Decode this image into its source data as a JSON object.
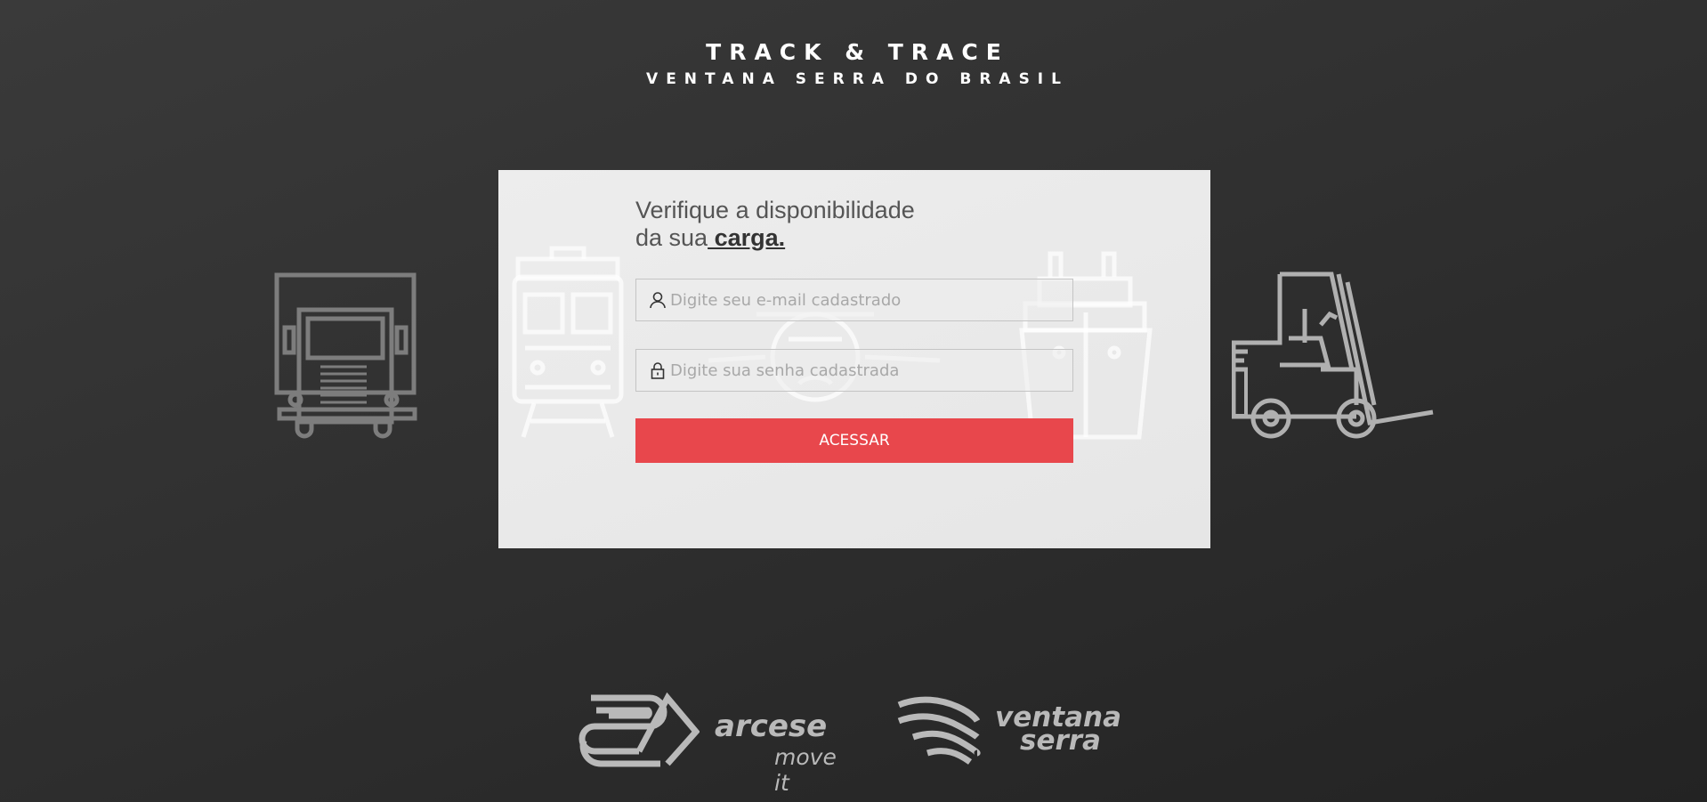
{
  "header": {
    "title": "TRACK & TRACE",
    "subtitle": "VENTANA SERRA DO BRASIL"
  },
  "card": {
    "heading_line1": "Verifique a disponibilidade",
    "heading_line2_prefix": "da sua",
    "heading_line2_emphasis": " carga."
  },
  "form": {
    "email": {
      "value": "",
      "placeholder": "Digite seu e-mail cadastrado",
      "icon": "user-icon"
    },
    "password": {
      "value": "",
      "placeholder": "Digite sua senha cadastrada",
      "icon": "lock-icon"
    },
    "submit_label": "ACESSAR"
  },
  "logos": {
    "arcese": {
      "name": "arcese",
      "tagline": "move it"
    },
    "ventana": {
      "line1": "ventana",
      "line2": "serra"
    }
  },
  "icons": [
    "truck-icon",
    "train-icon",
    "airplane-icon",
    "ship-icon",
    "forklift-icon"
  ],
  "colors": {
    "accent": "#e8474c",
    "background": "#2e2e2e",
    "card": "#eaeaea",
    "logo": "#b9b9b9"
  }
}
